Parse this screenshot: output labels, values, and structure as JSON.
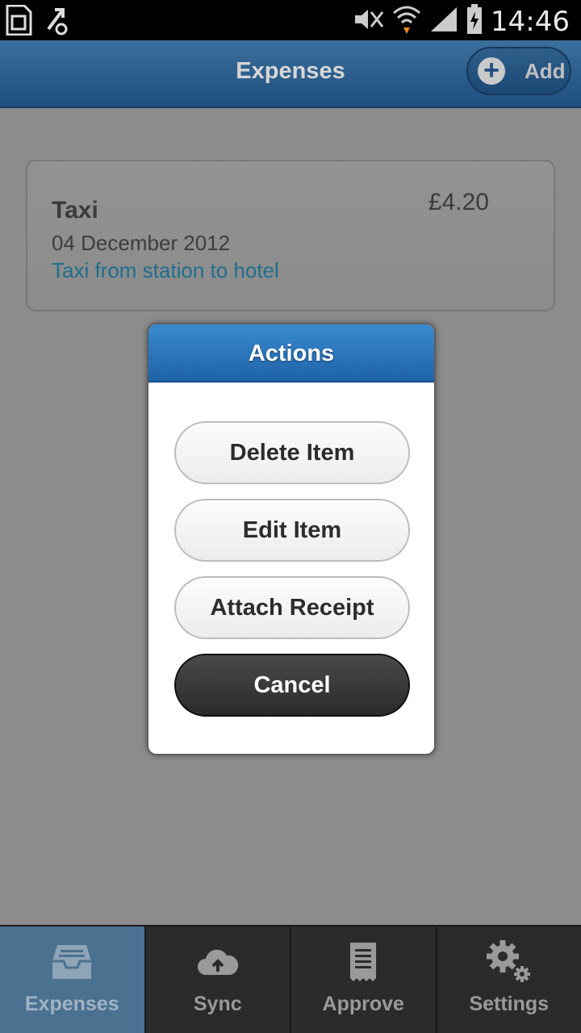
{
  "status_bar": {
    "time": "14:46",
    "icons": [
      "sim-card-icon",
      "usb-debug-icon",
      "mute-icon",
      "wifi-icon",
      "signal-icon",
      "battery-charging-icon"
    ]
  },
  "header": {
    "title": "Expenses",
    "add_label": "Add",
    "add_icon": "plus-circle-icon"
  },
  "expense": {
    "title": "Taxi",
    "date": "04 December 2012",
    "description": "Taxi from station to hotel",
    "amount": "£4.20"
  },
  "dialog": {
    "title": "Actions",
    "buttons": [
      "Delete Item",
      "Edit Item",
      "Attach Receipt",
      "Cancel"
    ]
  },
  "tabs": [
    {
      "label": "Expenses",
      "icon": "inbox-tray-icon",
      "active": true
    },
    {
      "label": "Sync",
      "icon": "cloud-upload-icon",
      "active": false
    },
    {
      "label": "Approve",
      "icon": "receipt-icon",
      "active": false
    },
    {
      "label": "Settings",
      "icon": "gears-icon",
      "active": false
    }
  ],
  "colors": {
    "header": "#2c5f8e",
    "dialog_header": "#2a76bd",
    "link": "#1e6f8e",
    "active_tab": "#4b7191"
  }
}
